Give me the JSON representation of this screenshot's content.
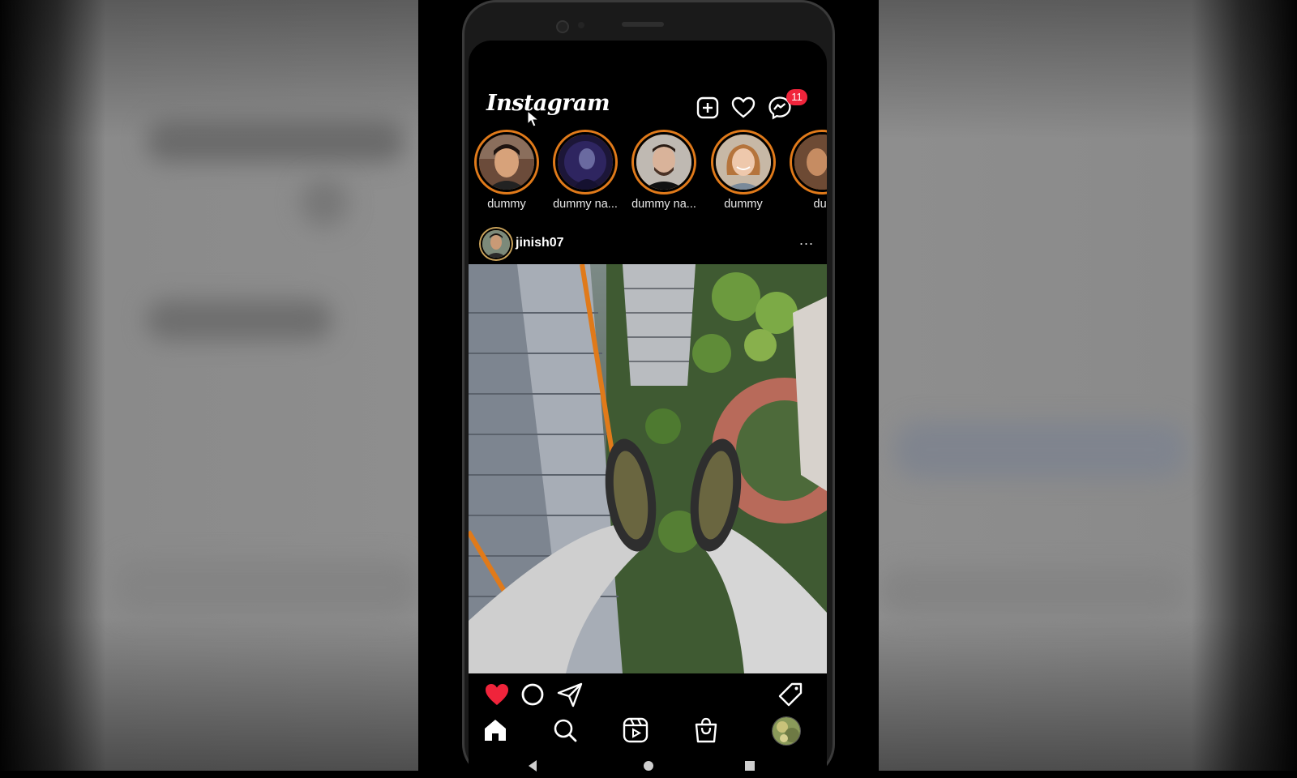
{
  "app": {
    "logo_text": "Instagram",
    "notification_count": "11"
  },
  "header": {
    "icons": [
      "plus-square-icon",
      "heart-icon",
      "messenger-icon"
    ]
  },
  "stories": [
    {
      "label": "dummy"
    },
    {
      "label": "dummy na..."
    },
    {
      "label": "dummy na..."
    },
    {
      "label": "dummy"
    },
    {
      "label": "dur"
    }
  ],
  "post": {
    "username": "jinish07",
    "more_label": "...",
    "liked": true
  },
  "actions": {
    "icons": [
      "heart-filled-icon",
      "comment-icon",
      "share-icon",
      "tag-icon"
    ]
  },
  "bottom_nav": {
    "icons": [
      "home-icon",
      "search-icon",
      "reels-icon",
      "shop-icon",
      "profile-avatar"
    ]
  },
  "colors": {
    "story_ring": "#e07a1a",
    "badge": "#f0243b",
    "like": "#f0243b",
    "background": "#000000"
  }
}
